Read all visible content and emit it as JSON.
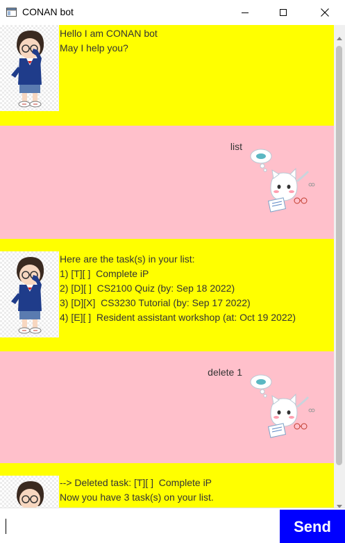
{
  "window": {
    "title": "CONAN bot",
    "icon": "app-window-icon"
  },
  "controls": {
    "minimize_icon": "minimize-icon",
    "maximize_icon": "maximize-icon",
    "close_icon": "close-icon"
  },
  "messages": [
    {
      "sender": "bot",
      "avatar": "conan-avatar",
      "lines": [
        "Hello I am CONAN bot",
        "May I help you?"
      ]
    },
    {
      "sender": "user",
      "avatar": "white-cat-avatar",
      "text": "list"
    },
    {
      "sender": "bot",
      "avatar": "conan-avatar",
      "lines": [
        "Here are the task(s) in your list:",
        "1) [T][ ]  Complete iP",
        "2) [D][ ]  CS2100 Quiz (by: Sep 18 2022)",
        "3) [D][X]  CS3230 Tutorial (by: Sep 17 2022)",
        "4) [E][ ]  Resident assistant workshop (at: Oct 19 2022)"
      ]
    },
    {
      "sender": "user",
      "avatar": "white-cat-avatar",
      "text": "delete 1"
    },
    {
      "sender": "bot",
      "avatar": "conan-avatar",
      "lines": [
        "--> Deleted task: [T][ ]  Complete iP",
        "Now you have 3 task(s) on your list."
      ]
    }
  ],
  "input": {
    "value": "",
    "placeholder": ""
  },
  "send_button": {
    "label": "Send"
  },
  "colors": {
    "bot_bubble": "#ffff00",
    "user_bubble": "#ffc0cb",
    "send_button": "#0000ff"
  }
}
